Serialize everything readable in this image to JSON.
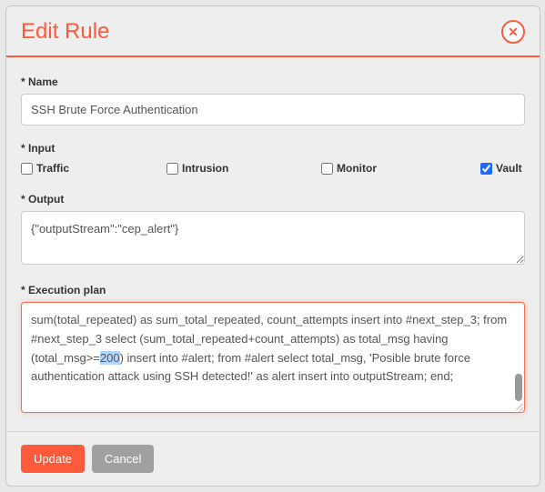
{
  "header": {
    "title": "Edit Rule",
    "close_glyph": "✕"
  },
  "fields": {
    "name": {
      "label": "* Name",
      "value": "SSH Brute Force Authentication"
    },
    "input": {
      "label": "* Input",
      "options": [
        {
          "label": "Traffic",
          "checked": false
        },
        {
          "label": "Intrusion",
          "checked": false
        },
        {
          "label": "Monitor",
          "checked": false
        },
        {
          "label": "Vault",
          "checked": true
        }
      ]
    },
    "output": {
      "label": "* Output",
      "value": "{\"outputStream\":\"cep_alert\"}"
    },
    "execution": {
      "label": "* Execution plan",
      "before_highlight": "sum(total_repeated) as sum_total_repeated, count_attempts insert into #next_step_3; from #next_step_3 select (sum_total_repeated+count_attempts) as total_msg having (total_msg>=",
      "highlight": "200",
      "after_highlight": ") insert into #alert; from #alert select total_msg, 'Posible brute force authentication attack using SSH detected!' as alert insert into outputStream; end;"
    }
  },
  "footer": {
    "update": "Update",
    "cancel": "Cancel"
  }
}
